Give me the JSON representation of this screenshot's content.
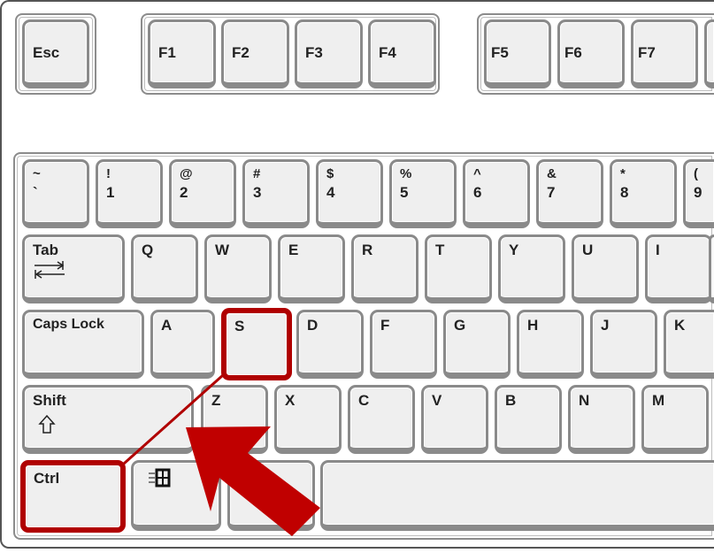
{
  "accent_color": "#b00000",
  "function_row": [
    "Esc",
    "F1",
    "F2",
    "F3",
    "F4",
    "F5",
    "F6",
    "F7"
  ],
  "number_row": [
    {
      "top": "~",
      "bottom": "`"
    },
    {
      "top": "!",
      "bottom": "1"
    },
    {
      "top": "@",
      "bottom": "2"
    },
    {
      "top": "#",
      "bottom": "3"
    },
    {
      "top": "$",
      "bottom": "4"
    },
    {
      "top": "%",
      "bottom": "5"
    },
    {
      "top": "^",
      "bottom": "6"
    },
    {
      "top": "&",
      "bottom": "7"
    },
    {
      "top": "*",
      "bottom": "8"
    },
    {
      "top": "(",
      "bottom": "9"
    }
  ],
  "tab_row": [
    "Tab",
    "Q",
    "W",
    "E",
    "R",
    "T",
    "Y",
    "U",
    "I"
  ],
  "caps_row": [
    "Caps Lock",
    "A",
    "S",
    "D",
    "F",
    "G",
    "H",
    "J",
    "K"
  ],
  "shift_row": [
    "Shift",
    "Z",
    "X",
    "C",
    "V",
    "B",
    "N",
    "M"
  ],
  "bottom_row": [
    "Ctrl"
  ],
  "icons": {
    "tab": "tab-arrows-icon",
    "shift": "shift-arrow-icon",
    "windows": "windows-logo-icon"
  },
  "highlighted_keys": [
    "Ctrl",
    "S"
  ]
}
